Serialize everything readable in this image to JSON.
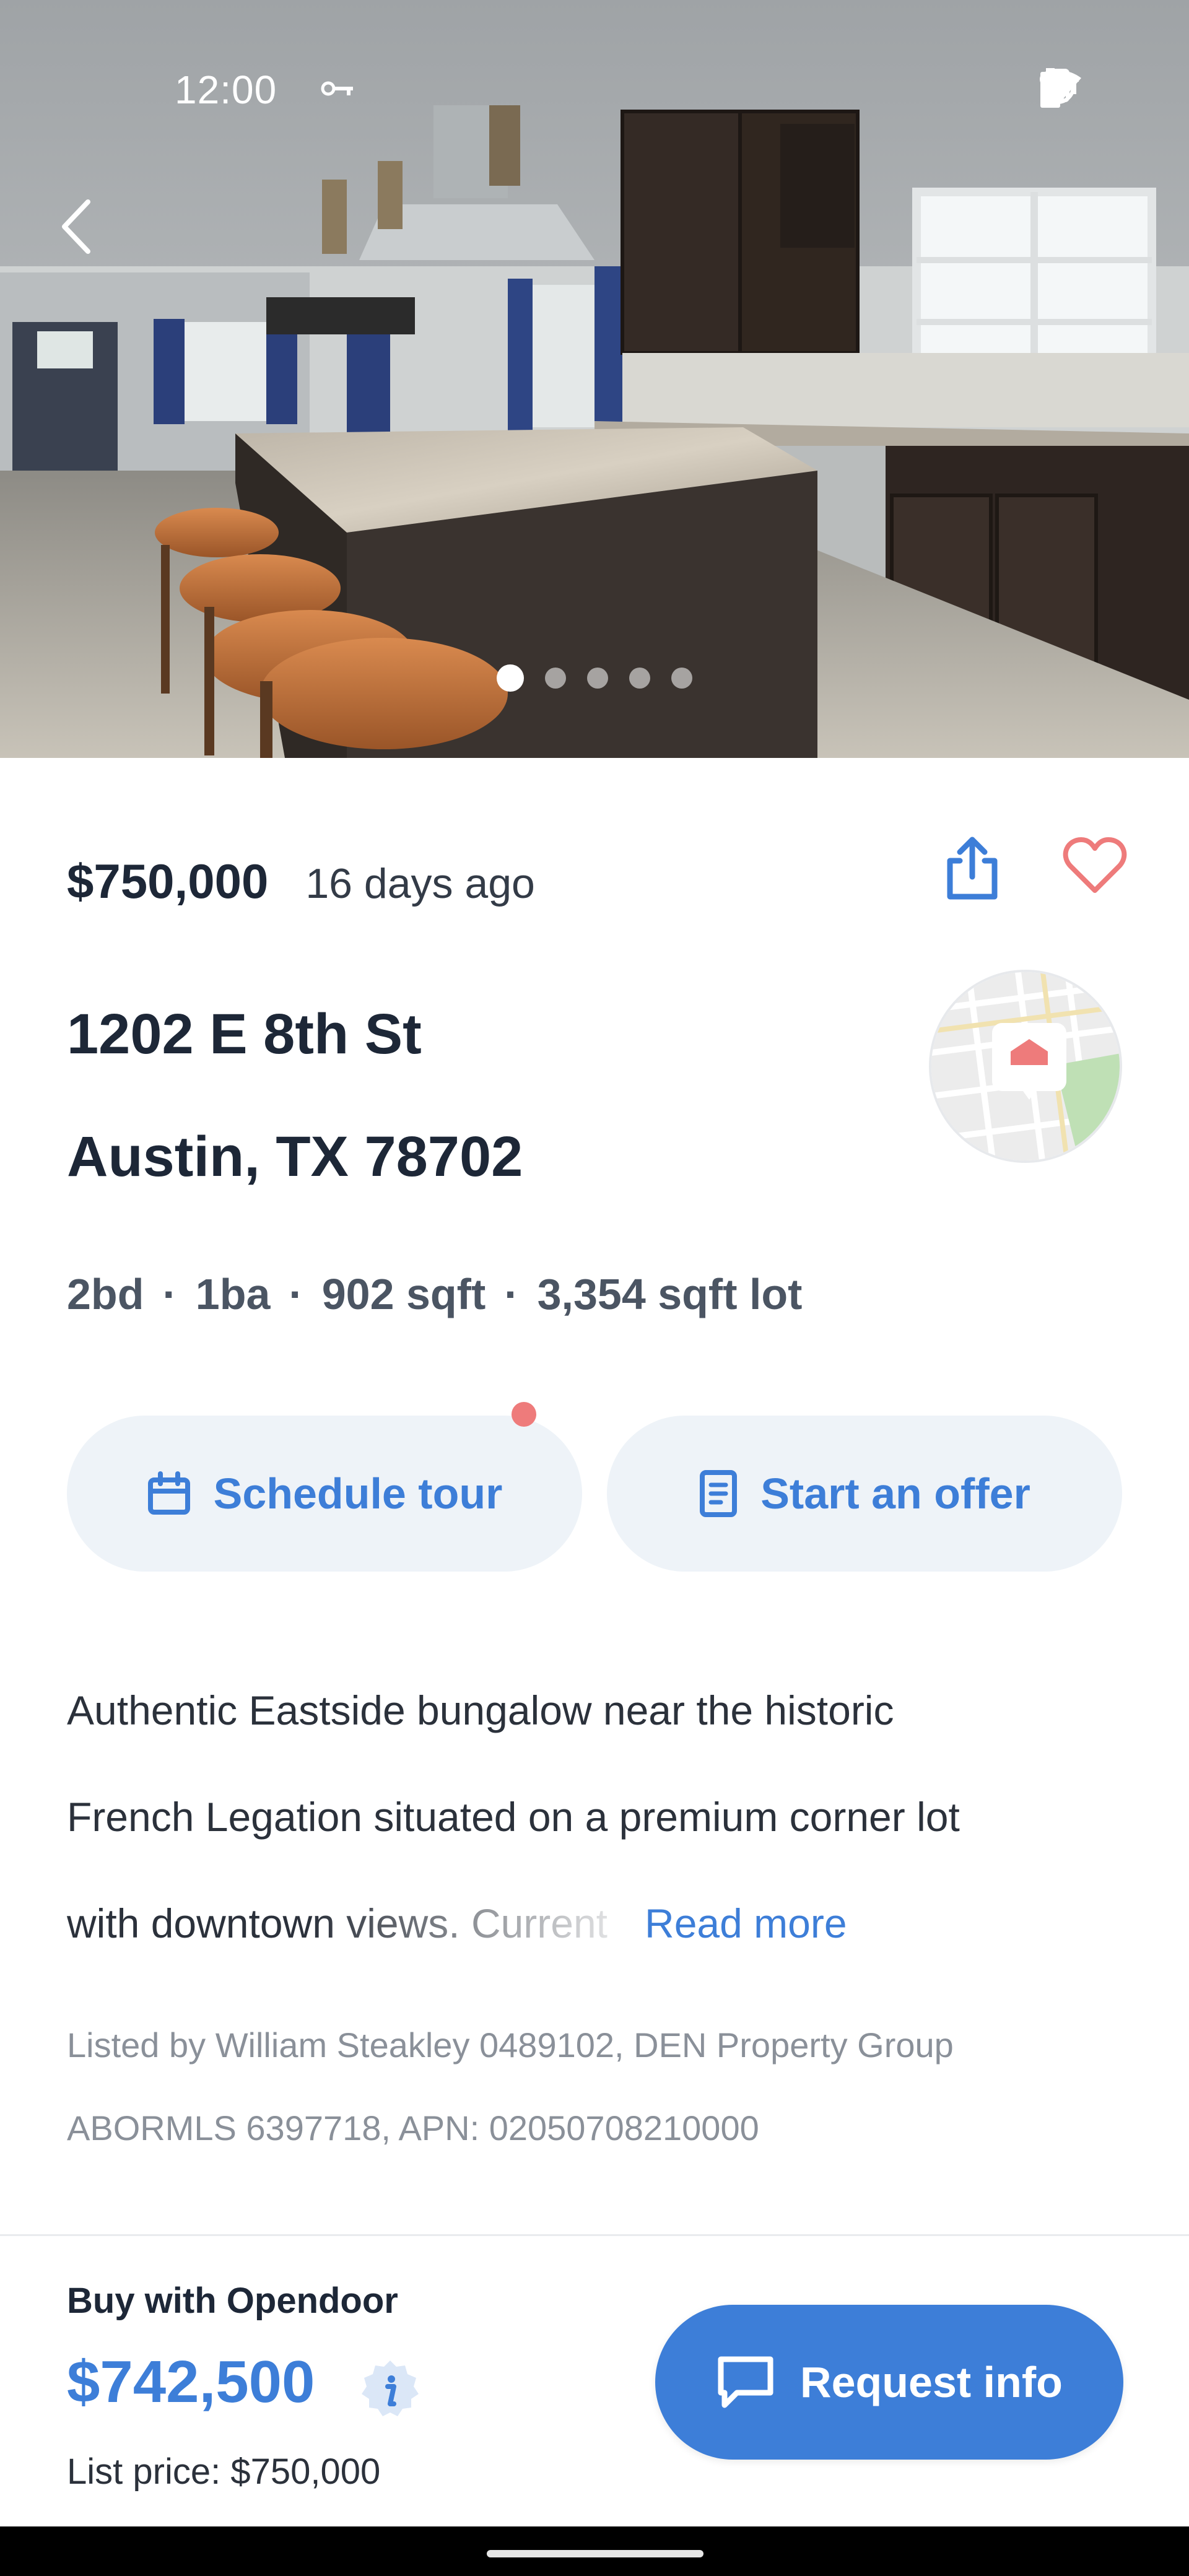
{
  "status_bar": {
    "time": "12:00",
    "icons": [
      "key-icon",
      "vpn-key-icon",
      "vibrate-icon",
      "do-not-disturb-icon",
      "wifi-icon",
      "battery-icon"
    ]
  },
  "gallery": {
    "photo_count": 5,
    "active_index": 1
  },
  "listing": {
    "price": "$750,000",
    "age": "16 days ago",
    "address_line1": "1202 E 8th St",
    "address_line2": "Austin, TX 78702",
    "beds": "2bd",
    "baths": "1ba",
    "sqft": "902 sqft",
    "lot": "3,354 sqft lot",
    "separator": "·"
  },
  "actions": {
    "schedule_tour": "Schedule tour",
    "start_offer": "Start an offer"
  },
  "description": {
    "line1": "Authentic Eastside bungalow near the historic",
    "line2": "French Legation situated on a premium corner lot",
    "line3": "with downtown views. Current",
    "read_more": "Read more"
  },
  "listing_info": {
    "listed_by": "Listed by William Steakley 0489102, DEN Property Group",
    "mls": "ABORMLS 6397718, APN: 02050708210000"
  },
  "opendoor": {
    "label": "Buy with Opendoor",
    "price": "$742,500",
    "list_price": "List price: $750,000",
    "request_button": "Request info"
  },
  "colors": {
    "accent_blue": "#3d7ed8",
    "heart_red": "#ee7b7b",
    "pill_bg": "#eef3f8",
    "text_dark": "#1d2737"
  }
}
